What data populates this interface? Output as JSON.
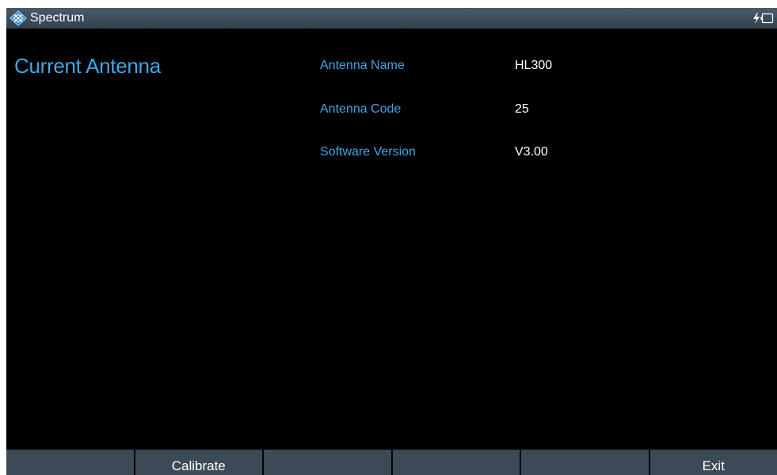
{
  "app": {
    "title": "Spectrum",
    "logo_icon": "rohde-schwarz-diamond-icon",
    "status_icons": [
      "lightning-icon",
      "battery-icon"
    ]
  },
  "panel": {
    "title": "Current Antenna"
  },
  "antenna_info": [
    {
      "label": "Antenna Name",
      "value": "HL300"
    },
    {
      "label": "Antenna Code",
      "value": "25"
    },
    {
      "label": "Software Version",
      "value": "V3.00"
    }
  ],
  "softkeys": [
    "",
    "Calibrate",
    "",
    "",
    "",
    "Exit"
  ],
  "colors": {
    "background": "#000000",
    "accent": "#3fa6e8",
    "titlebar": "#3f4d5b",
    "softkey": "#3c4a58",
    "text": "#ffffff"
  }
}
